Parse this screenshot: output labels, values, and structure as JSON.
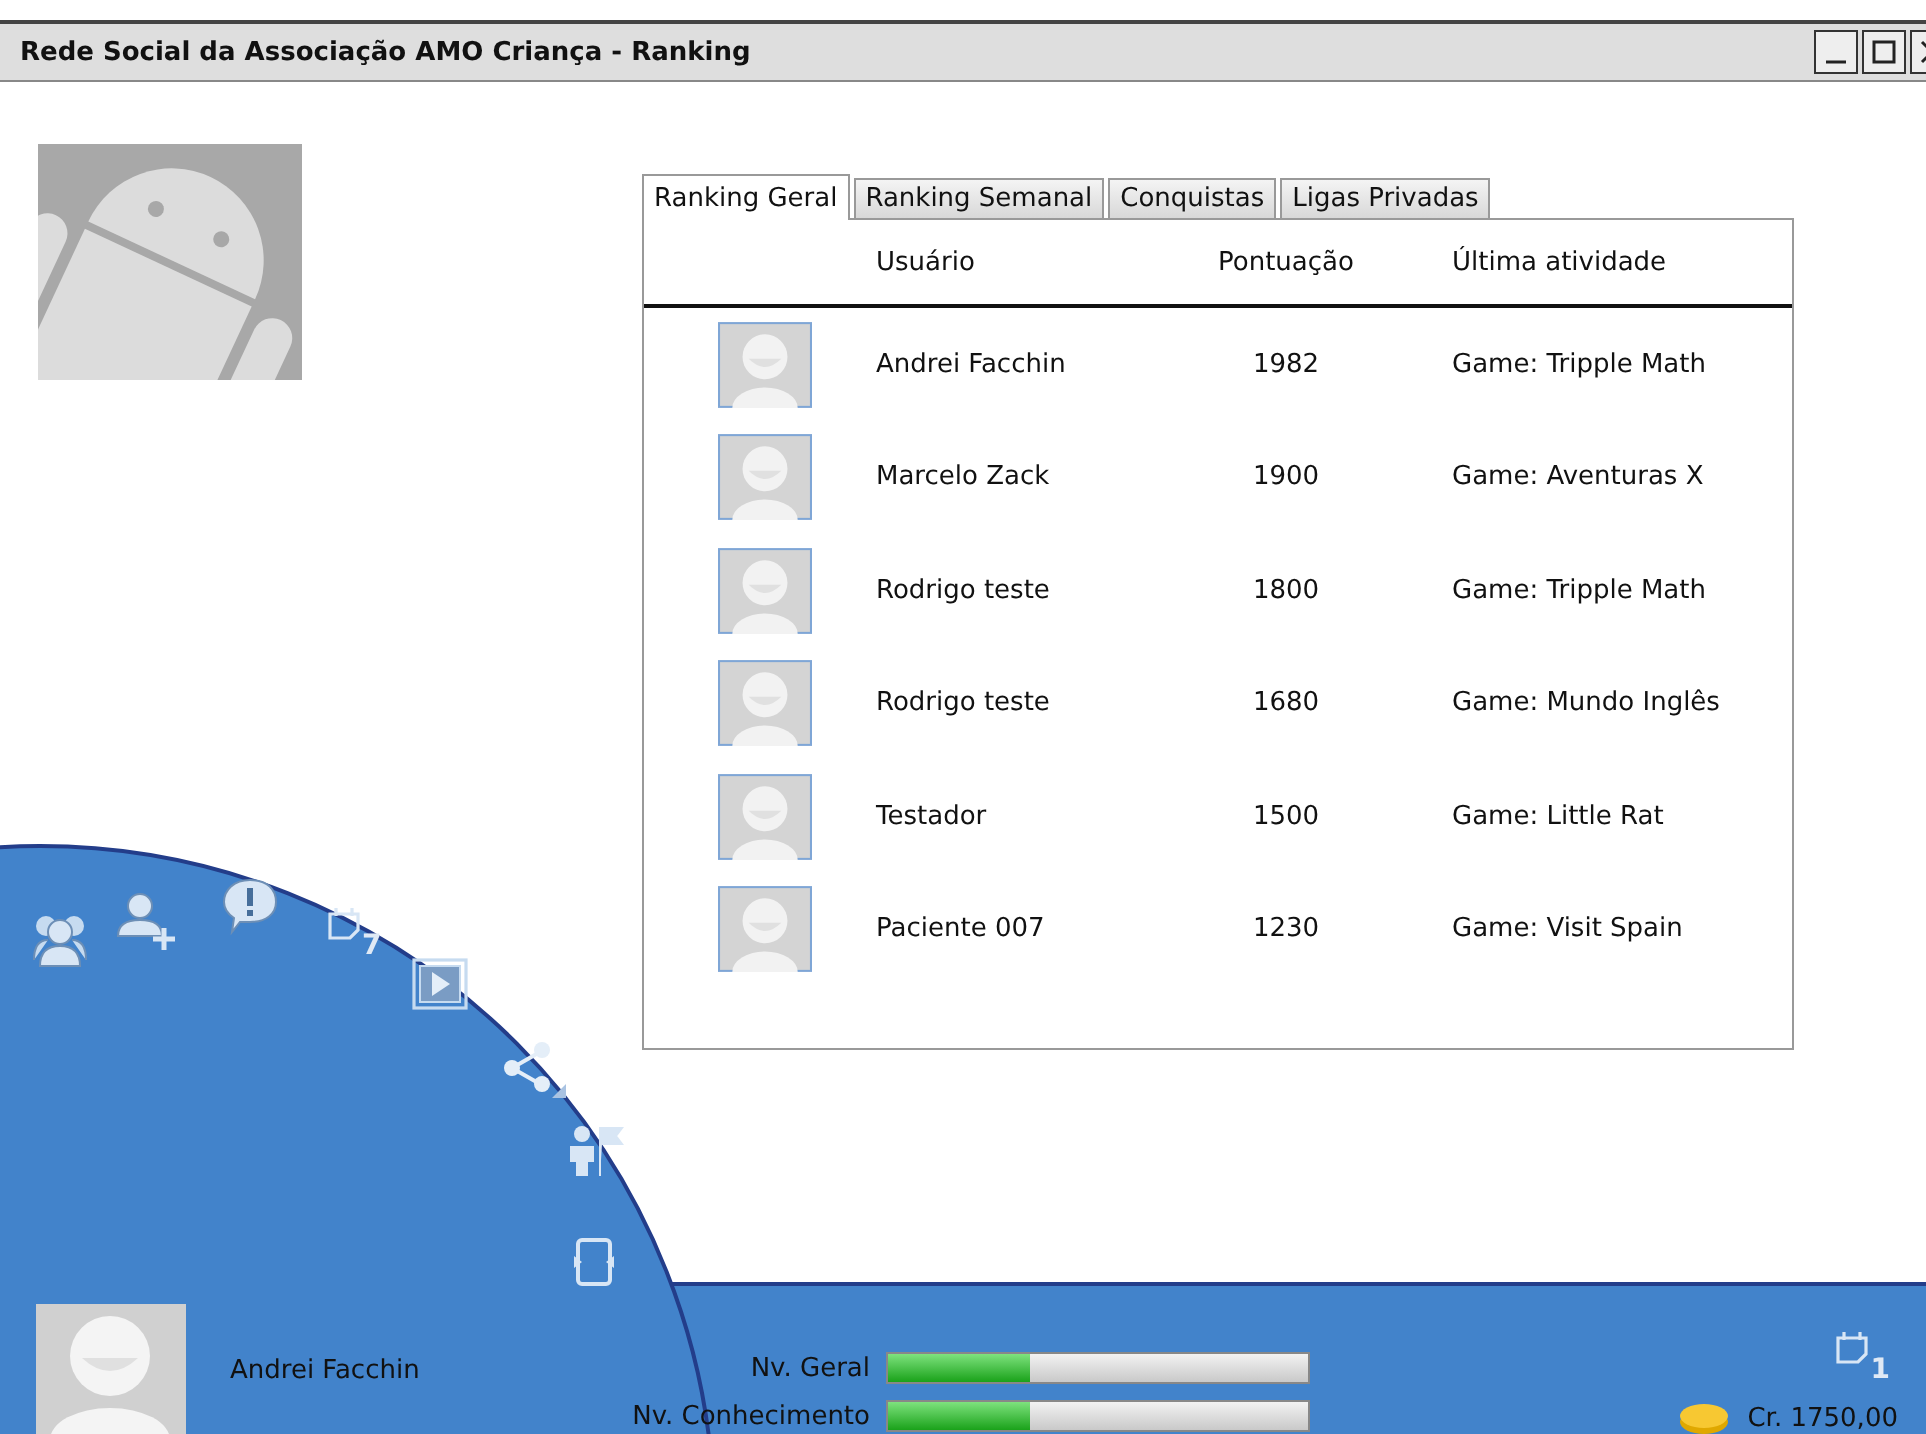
{
  "window": {
    "title": "Rede Social da Associação AMO Criança - Ranking"
  },
  "tabs": [
    {
      "label": "Ranking Geral",
      "selected": true
    },
    {
      "label": "Ranking Semanal",
      "selected": false
    },
    {
      "label": "Conquistas",
      "selected": false
    },
    {
      "label": "Ligas Privadas",
      "selected": false
    }
  ],
  "table": {
    "columns": [
      "Usuário",
      "Pontuação",
      "Última atividade"
    ],
    "rows": [
      {
        "user": "Andrei Facchin",
        "score": "1982",
        "activity": "Game: Tripple Math"
      },
      {
        "user": "Marcelo Zack",
        "score": "1900",
        "activity": "Game: Aventuras X"
      },
      {
        "user": "Rodrigo teste",
        "score": "1800",
        "activity": "Game: Tripple Math"
      },
      {
        "user": "Rodrigo teste",
        "score": "1680",
        "activity": "Game: Mundo Inglês"
      },
      {
        "user": "Testador",
        "score": "1500",
        "activity": "Game: Little Rat"
      },
      {
        "user": "Paciente 007",
        "score": "1230",
        "activity": "Game: Visit Spain"
      }
    ]
  },
  "menu": {
    "calendar_badge": "7"
  },
  "user": {
    "name": "Andrei Facchin"
  },
  "levels": [
    {
      "label": "Nv. Geral",
      "level": 0.34
    },
    {
      "label": "Nv. Conhecimento",
      "level": 0.34
    }
  ],
  "notifications": {
    "count": "1"
  },
  "credits": "Cr. 1750,00"
}
